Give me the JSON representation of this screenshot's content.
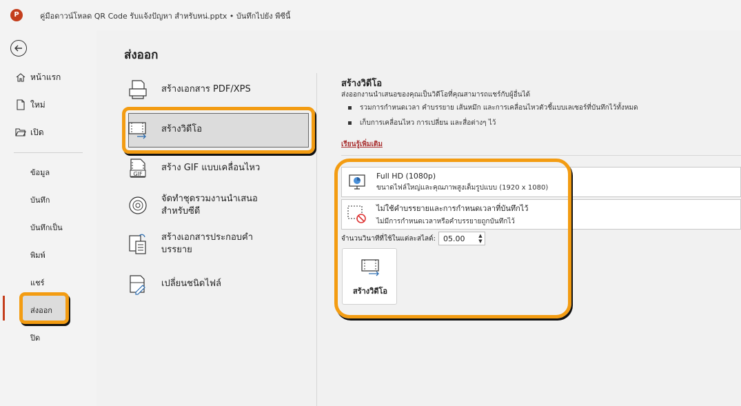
{
  "titlebar": {
    "app_logo": "P",
    "title": "คู่มือดาวน์โหลด QR Code รับแจ้งปัญหา สำหรับหน่.pptx • บันทึกไปยัง พีซีนี้"
  },
  "sidebar": {
    "items": [
      {
        "label": "หน้าแรก",
        "icon": "home-icon"
      },
      {
        "label": "ใหม่",
        "icon": "new-file-icon"
      },
      {
        "label": "เปิด",
        "icon": "folder-open-icon"
      }
    ],
    "sub_items": [
      "ข้อมูล",
      "บันทึก",
      "บันทึกเป็น",
      "พิมพ์",
      "แชร์",
      "ส่งออก",
      "ปิด"
    ],
    "active": "ส่งออก"
  },
  "main": {
    "title": "ส่งออก",
    "options": [
      {
        "label": "สร้างเอกสาร PDF/XPS",
        "icon": "pdf-xps-icon"
      },
      {
        "label": "สร้างวิดีโอ",
        "icon": "video-icon"
      },
      {
        "label": "สร้าง GIF แบบเคลื่อนไหว",
        "icon": "gif-icon"
      },
      {
        "label_line1": "จัดทำชุดรวมงานนำเสนอ",
        "label_line2": "สำหรับซีดี",
        "icon": "cd-icon"
      },
      {
        "label_line1": "สร้างเอกสารประกอบคำ",
        "label_line2": "บรรยาย",
        "icon": "handouts-icon"
      },
      {
        "label": "เปลี่ยนชนิดไฟล์",
        "icon": "change-file-type-icon"
      }
    ]
  },
  "panel": {
    "title": "สร้างวิดีโอ",
    "description": "ส่งออกงานนำเสนอของคุณเป็นวิดีโอที่คุณสามารถแชร์กับผู้อื่นได้",
    "bullets": [
      "รวมการกำหนดเวลา คำบรรยาย เส้นหมึก และการเคลื่อนไหวตัวชี้แบบเลเซอร์ที่บันทึกไว้ทั้งหมด",
      "เก็บการเคลื่อนไหว การเปลี่ยน และสื่อต่างๆ ไว้"
    ],
    "learn_more": "เรียนรู้เพิ่มเติม",
    "quality": {
      "main": "Full HD (1080p)",
      "sub": "ขนาดไฟล์ใหญ่และคุณภาพสูงเต็มรูปแบบ (1920 x 1080)"
    },
    "timing": {
      "main": "ไม่ใช้คำบรรยายและการกำหนดเวลาที่บันทึกไว้",
      "sub": "ไม่มีการกำหนดเวลาหรือคำบรรยายถูกบันทึกไว้"
    },
    "seconds_label": "จำนวนวินาทีที่ใช้ในแต่ละสไลด์:",
    "seconds_value": "05.00",
    "create_button": "สร้างวิดีโอ"
  },
  "colors": {
    "accent": "#c43e1c",
    "highlight": "#f39c12"
  }
}
